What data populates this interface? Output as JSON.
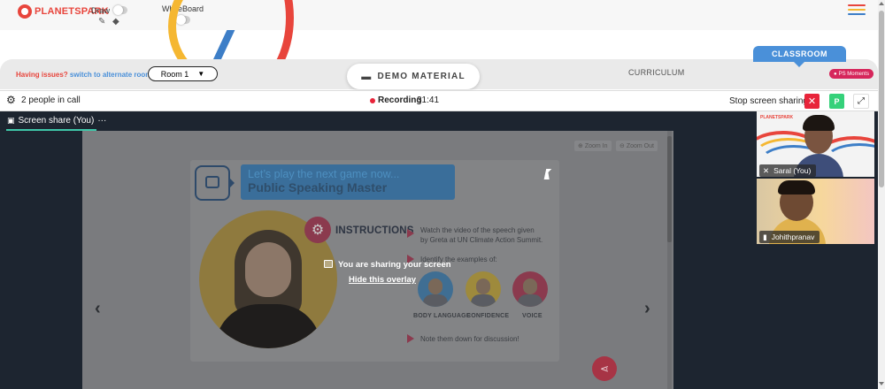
{
  "brand": {
    "logo_text": "PLANETSPARK"
  },
  "toolbar": {
    "draw_label": "Draw",
    "whiteboard_label": "WhiteBoard",
    "pencil_icon": "pencil-icon",
    "eraser_icon": "eraser-icon",
    "menu_colors": [
      "#e8453c",
      "#f5b731",
      "#3d7ec7"
    ]
  },
  "room_bar": {
    "issue_prefix": "Having issues?",
    "issue_link": "switch to alternate room",
    "room_selected": "Room 1",
    "demo_material_label": "DEMO MATERIAL",
    "curriculum_label": "CURRICULUM",
    "classroom_tab": "CLASSROOM",
    "ps_moments": "PS Moments"
  },
  "call_bar": {
    "people_count": "2 people in call",
    "recording_label": "Recording",
    "recording_time": "31:41",
    "stop_sharing_label": "Stop screen sharing",
    "close_label": "✕",
    "p_label": "P",
    "expand_label": "⤢"
  },
  "share": {
    "tab_label": "Screen share (You)",
    "tab_more": "···",
    "zoom_in": "Zoom In",
    "zoom_out": "Zoom Out",
    "overlay_text": "You are sharing your screen",
    "overlay_link": "Hide this overlay"
  },
  "slide": {
    "title_line1": "Let’s play the next game now...",
    "title_line2": "Public Speaking Master",
    "instructions_title": "INSTRUCTIONS",
    "instruction_1a": "Watch the video of the speech given",
    "instruction_1b": "by Greta at UN Climate Action Summit.",
    "instruction_2": "Identify the examples of:",
    "examples": [
      "BODY LANGUAGE",
      "CONFIDENCE",
      "VOICE"
    ],
    "instruction_3": "Note them down for discussion!"
  },
  "participants": [
    {
      "name": "Saral (You)",
      "logo": "PLANETSPARK"
    },
    {
      "name": "Johithpranav"
    }
  ],
  "colors": {
    "brand_red": "#e8453c",
    "recording_red": "#e8243a",
    "accent_blue": "#4a90d9",
    "ps_pink": "#d6265b",
    "green": "#35d17a",
    "stage_dark": "#1d2530"
  }
}
